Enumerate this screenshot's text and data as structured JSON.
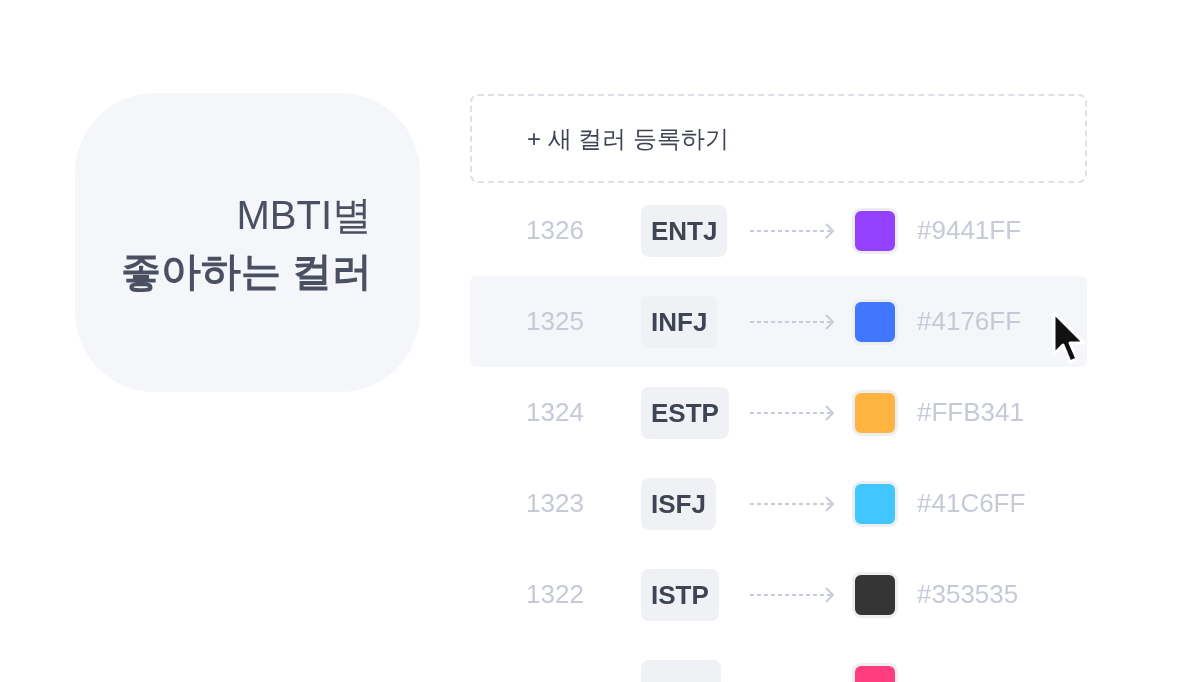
{
  "card": {
    "line_1": "MBTI별",
    "line_2": "좋아하는 컬러"
  },
  "add_button": {
    "label": "+ 새 컬러 등록하기"
  },
  "rows": [
    {
      "id": "1326",
      "type": "ENTJ",
      "color": "#9441ff",
      "hex": "#9441FF",
      "hovered": false
    },
    {
      "id": "1325",
      "type": "INFJ",
      "color": "#4176ff",
      "hex": "#4176FF",
      "hovered": true
    },
    {
      "id": "1324",
      "type": "ESTP",
      "color": "#ffb341",
      "hex": "#FFB341",
      "hovered": false
    },
    {
      "id": "1323",
      "type": "ISFJ",
      "color": "#41c6ff",
      "hex": "#41C6FF",
      "hovered": false
    },
    {
      "id": "1322",
      "type": "ISTP",
      "color": "#353535",
      "hex": "#353535",
      "hovered": false
    },
    {
      "color": "#ff3d7f"
    }
  ]
}
